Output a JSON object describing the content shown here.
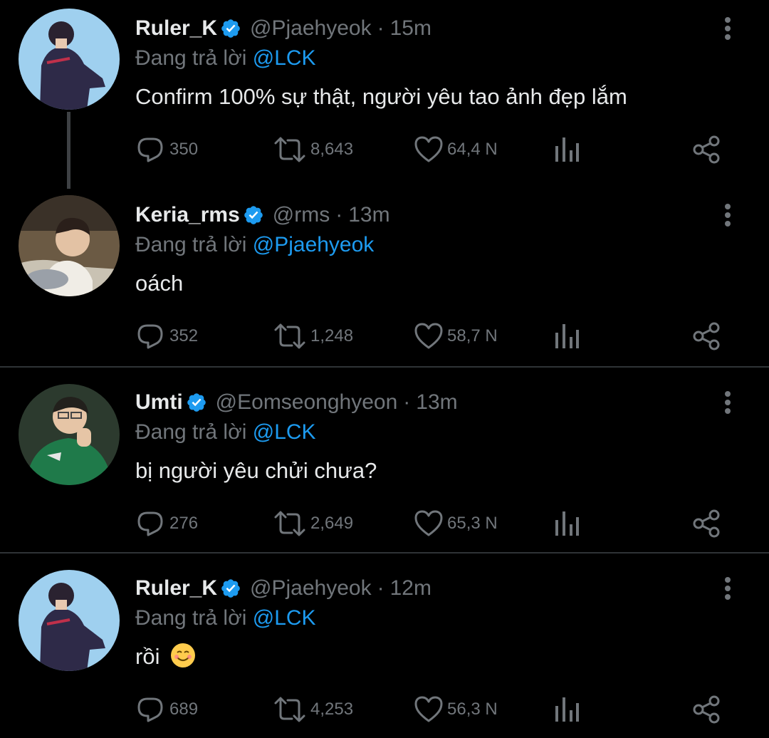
{
  "tweets": [
    {
      "name": "Ruler_K",
      "handle": "@Pjaehyeok",
      "dot": "·",
      "time": "15m",
      "reply_prefix": "Đang trả lời",
      "reply_to": "@LCK",
      "text": "Confirm 100% sự thật, người yêu tao ảnh đẹp lắm",
      "replies": "350",
      "retweets": "8,643",
      "likes": "64,4 N"
    },
    {
      "name": "Keria_rms",
      "handle": "@rms",
      "dot": "·",
      "time": "13m",
      "reply_prefix": "Đang trả lời",
      "reply_to": "@Pjaehyeok",
      "text": "oách",
      "replies": "352",
      "retweets": "1,248",
      "likes": "58,7 N"
    },
    {
      "name": "Umti",
      "handle": "@Eomseonghyeon",
      "dot": "·",
      "time": "13m",
      "reply_prefix": "Đang trả lời",
      "reply_to": "@LCK",
      "text": "bị người yêu chửi chưa?",
      "replies": "276",
      "retweets": "2,649",
      "likes": "65,3 N"
    },
    {
      "name": "Ruler_K",
      "handle": "@Pjaehyeok",
      "dot": "·",
      "time": "12m",
      "reply_prefix": "Đang trả lời",
      "reply_to": "@LCK",
      "text": "rồi",
      "text_emoji": "☺",
      "replies": "689",
      "retweets": "4,253",
      "likes": "56,3 N"
    }
  ],
  "colors": {
    "background": "#000000",
    "text": "#e7e9ea",
    "muted": "#71767b",
    "accent": "#1d9bf0",
    "divider": "#2f3336"
  },
  "icons": [
    "verified-badge-icon",
    "more-options-icon",
    "reply-icon",
    "retweet-icon",
    "like-icon",
    "views-icon",
    "share-icon"
  ]
}
